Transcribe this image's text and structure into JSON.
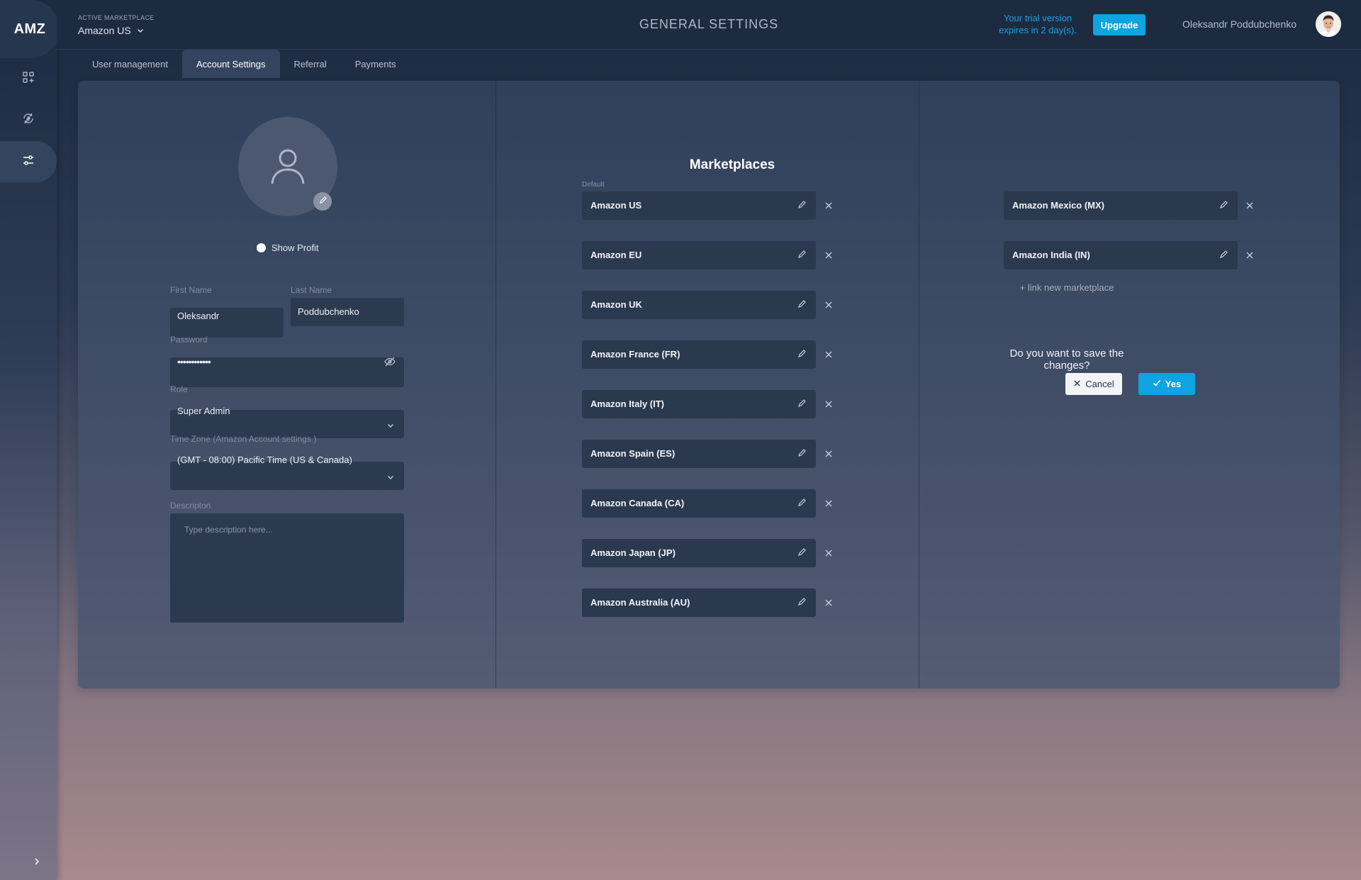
{
  "sidebar": {
    "logo": "AMZ",
    "items": [
      {
        "icon": "dashboard-add-icon"
      },
      {
        "icon": "sync-dollar-icon"
      },
      {
        "icon": "sliders-icon"
      }
    ],
    "expand_icon": "chevron-right-icon"
  },
  "header": {
    "active_marketplace_label": "ACTIVE MARKETPLACE",
    "active_marketplace_value": "Amazon US",
    "title": "GENERAL SETTINGS",
    "trial_line1": "Your trial version",
    "trial_line2": "expires in 2 day(s).",
    "upgrade_label": "Upgrade",
    "user_name": "Oleksandr Poddubchenko"
  },
  "tabs": [
    {
      "label": "User management",
      "active": false
    },
    {
      "label": "Account Settings",
      "active": true
    },
    {
      "label": "Referral",
      "active": false
    },
    {
      "label": "Payments",
      "active": false
    }
  ],
  "profile": {
    "show_profit_label": "Show Profit",
    "first_name_label": "First Name",
    "first_name_value": "Oleksandr",
    "last_name_label": "Last Name",
    "last_name_value": "Poddubchenko",
    "password_label": "Password",
    "password_value": "••••••••••••",
    "role_label": "Role",
    "role_value": "Super Admin",
    "timezone_label": "Time Zone (Amazon Account settings )",
    "timezone_value": "(GMT - 08:00) Pacific Time (US & Canada)",
    "description_label": "Descripton",
    "description_placeholder": "Type description here..."
  },
  "marketplaces": {
    "title": "Marketplaces",
    "default_label": "Default",
    "left": [
      "Amazon US",
      "Amazon EU",
      "Amazon UK",
      "Amazon France (FR)",
      "Amazon Italy (IT)",
      "Amazon Spain (ES)",
      "Amazon Canada (CA)",
      "Amazon Japan (JP)",
      "Amazon Australia (AU)"
    ],
    "right": [
      "Amazon Mexico (MX)",
      "Amazon India (IN)"
    ],
    "link_new_label": "+ link new marketplace"
  },
  "confirm": {
    "question": "Do you want to save the changes?",
    "cancel_label": "Cancel",
    "yes_label": "Yes"
  },
  "colors": {
    "accent": "#0ea3e1",
    "header_bg": "#1d2b41",
    "field_bg": "#2c3a50"
  }
}
